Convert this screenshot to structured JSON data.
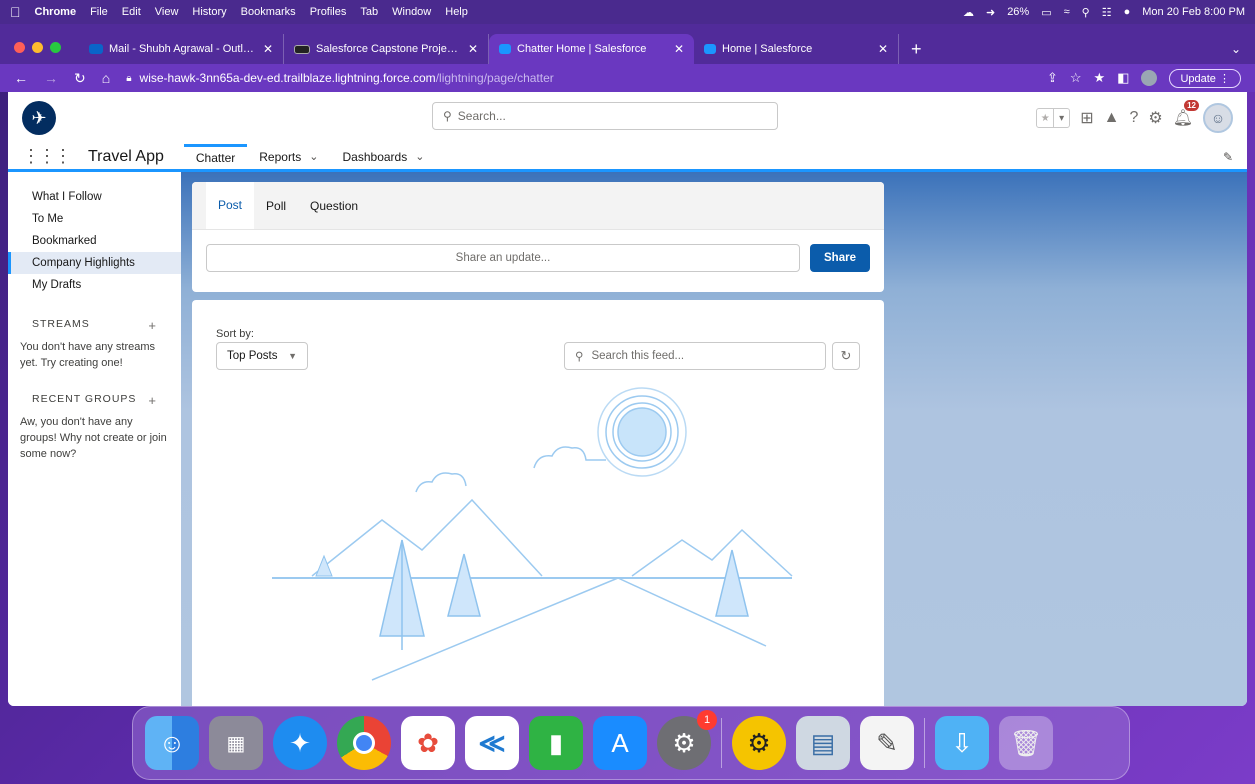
{
  "menubar": {
    "apple_icon": "apple-icon",
    "items": [
      "Chrome",
      "File",
      "Edit",
      "View",
      "History",
      "Bookmarks",
      "Profiles",
      "Tab",
      "Window",
      "Help"
    ],
    "battery": "26%",
    "datetime": "Mon 20 Feb 8:00 PM"
  },
  "tabs": [
    {
      "title": "Mail - Shubh Agrawal - Outlook",
      "icon": "outlook-icon",
      "active": false
    },
    {
      "title": "Salesforce Capstone Project -",
      "icon": "dbl-icon",
      "active": false
    },
    {
      "title": "Chatter Home | Salesforce",
      "icon": "salesforce-cloud-icon",
      "active": true
    },
    {
      "title": "Home | Salesforce",
      "icon": "salesforce-cloud-icon",
      "active": false
    }
  ],
  "toolbar": {
    "url_host": "wise-hawk-3nn65a-dev-ed.trailblaze.lightning.force.com",
    "url_path": "/lightning/page/chatter",
    "update_label": "Update"
  },
  "header": {
    "search_placeholder": "Search...",
    "notification_count": "12"
  },
  "nav": {
    "app_name": "Travel App",
    "items": [
      {
        "label": "Chatter",
        "active": true,
        "dropdown": false
      },
      {
        "label": "Reports",
        "active": false,
        "dropdown": true
      },
      {
        "label": "Dashboards",
        "active": false,
        "dropdown": true
      }
    ]
  },
  "left_nav": {
    "feeds": [
      "What I Follow",
      "To Me",
      "Bookmarked",
      "Company Highlights",
      "My Drafts"
    ],
    "active_feed": "Company Highlights",
    "streams_heading": "STREAMS",
    "streams_empty": "You don't have any streams yet. Try creating one!",
    "groups_heading": "RECENT GROUPS",
    "groups_empty": "Aw, you don't have any groups! Why not create or join some now?"
  },
  "publisher": {
    "tabs": [
      "Post",
      "Poll",
      "Question"
    ],
    "active_tab": "Post",
    "share_placeholder": "Share an update...",
    "share_label": "Share"
  },
  "feed": {
    "sort_label": "Sort by:",
    "sort_value": "Top Posts",
    "search_placeholder": "Search this feed..."
  },
  "dock": {
    "apps": [
      "finder",
      "launchpad",
      "safari",
      "chrome",
      "photos",
      "vscode",
      "numbers",
      "app-store",
      "system-settings",
      "bug-app",
      "preview",
      "textedit",
      "downloads-folder",
      "trash"
    ],
    "system_settings_badge": "1"
  },
  "colors": {
    "salesforce_blue": "#1b96ff",
    "brand_button": "#0b5cab",
    "navy": "#032d60",
    "badge_red": "#c23934"
  }
}
